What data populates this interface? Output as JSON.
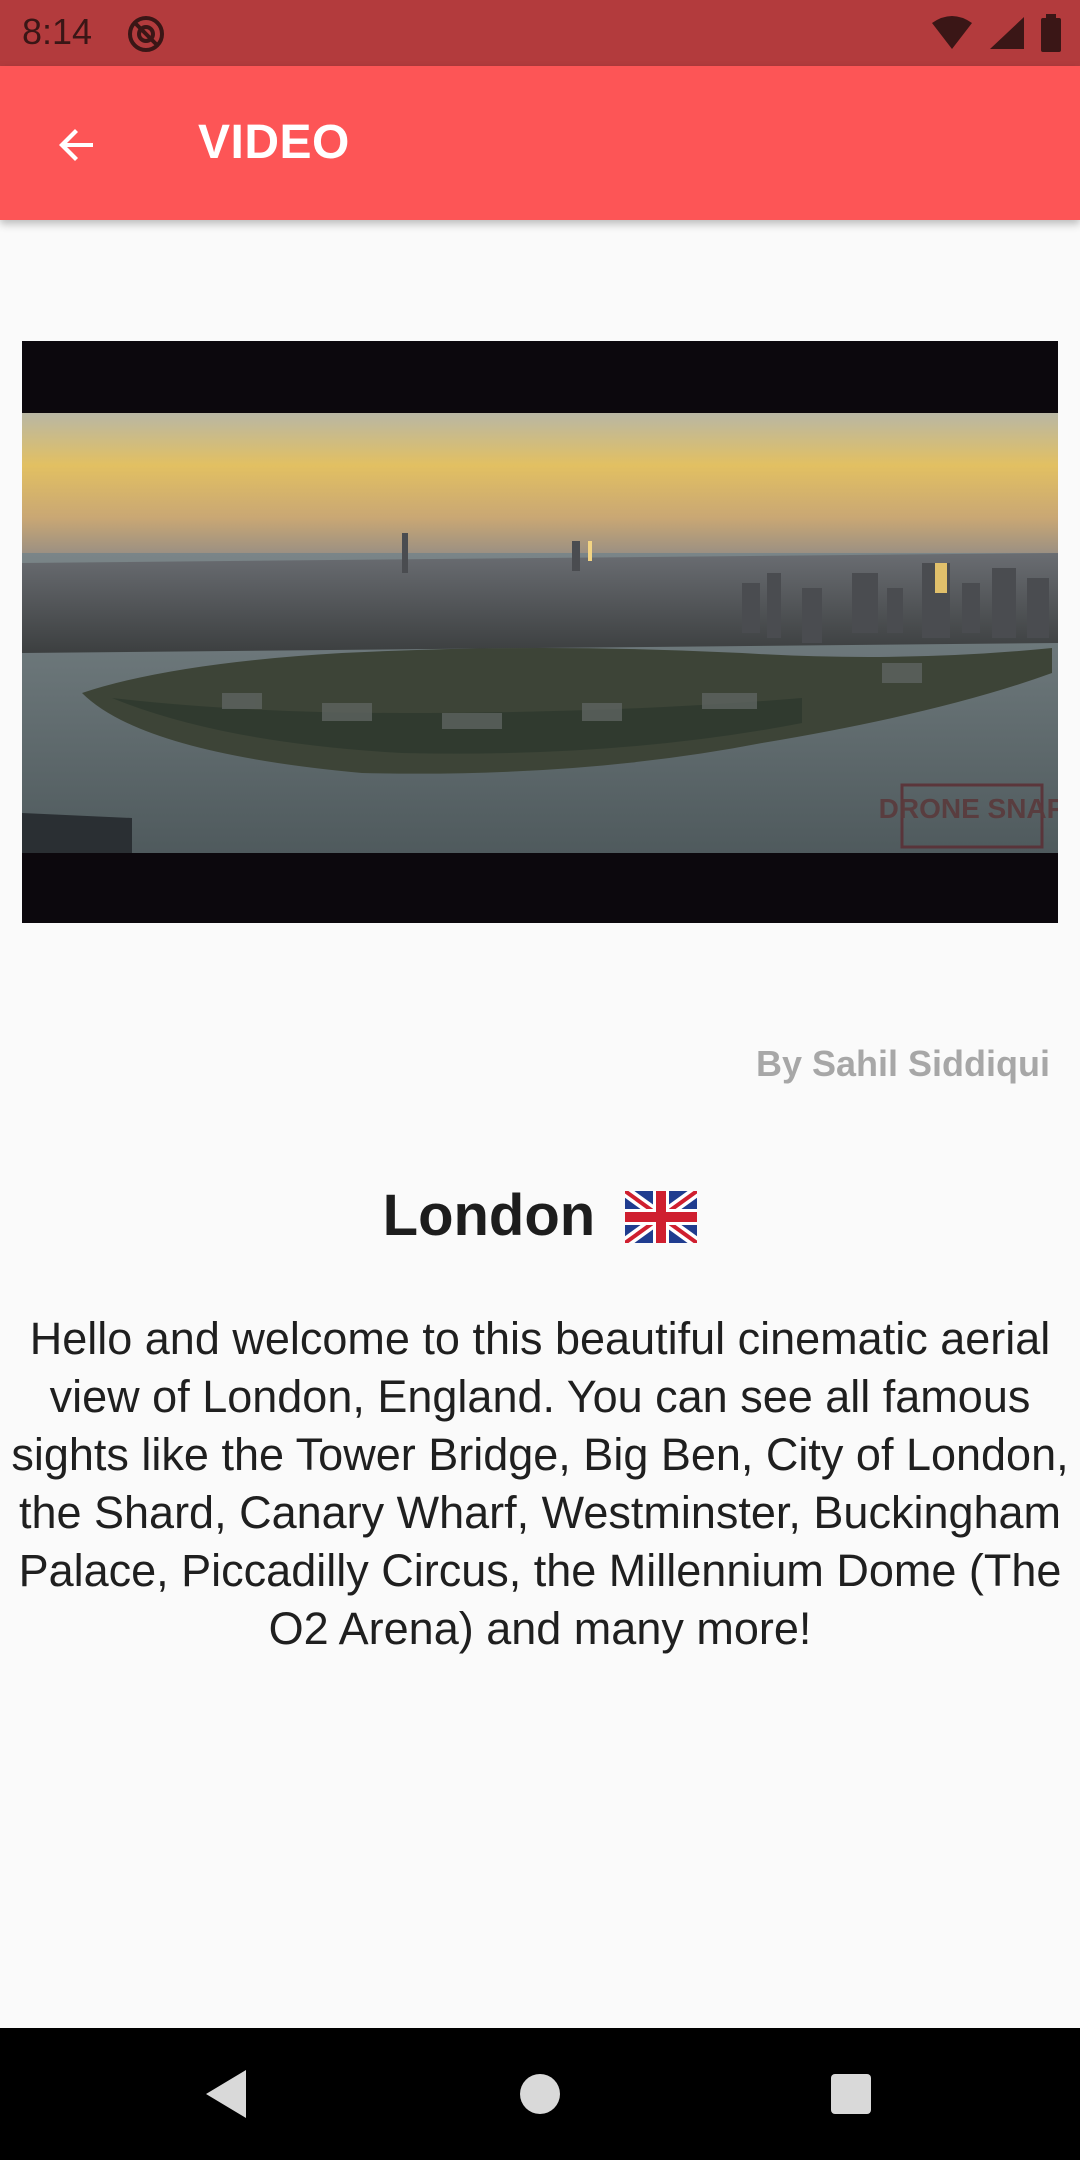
{
  "status_bar": {
    "time": "8:14",
    "icons": [
      "sync-icon",
      "wifi-icon",
      "signal-icon",
      "battery-icon"
    ]
  },
  "app_bar": {
    "back_icon": "arrow-back-icon",
    "title": "VIDEO",
    "color": "#fd5556"
  },
  "video": {
    "watermark": "DRONE SNAP"
  },
  "content": {
    "author": "By Sahil Siddiqui",
    "place": "London",
    "flag": "uk-flag-icon",
    "description": "Hello and welcome to this beautiful cinematic aerial view of London, England. You can see all famous sights like the Tower Bridge, Big Ben, City of London, the Shard, Canary Wharf, Westminster, Buckingham Palace, Piccadilly Circus, the Millennium Dome (The O2 Arena) and many more!"
  },
  "nav_bar": {
    "buttons": [
      "back-triangle-icon",
      "home-circle-icon",
      "recents-square-icon"
    ]
  }
}
